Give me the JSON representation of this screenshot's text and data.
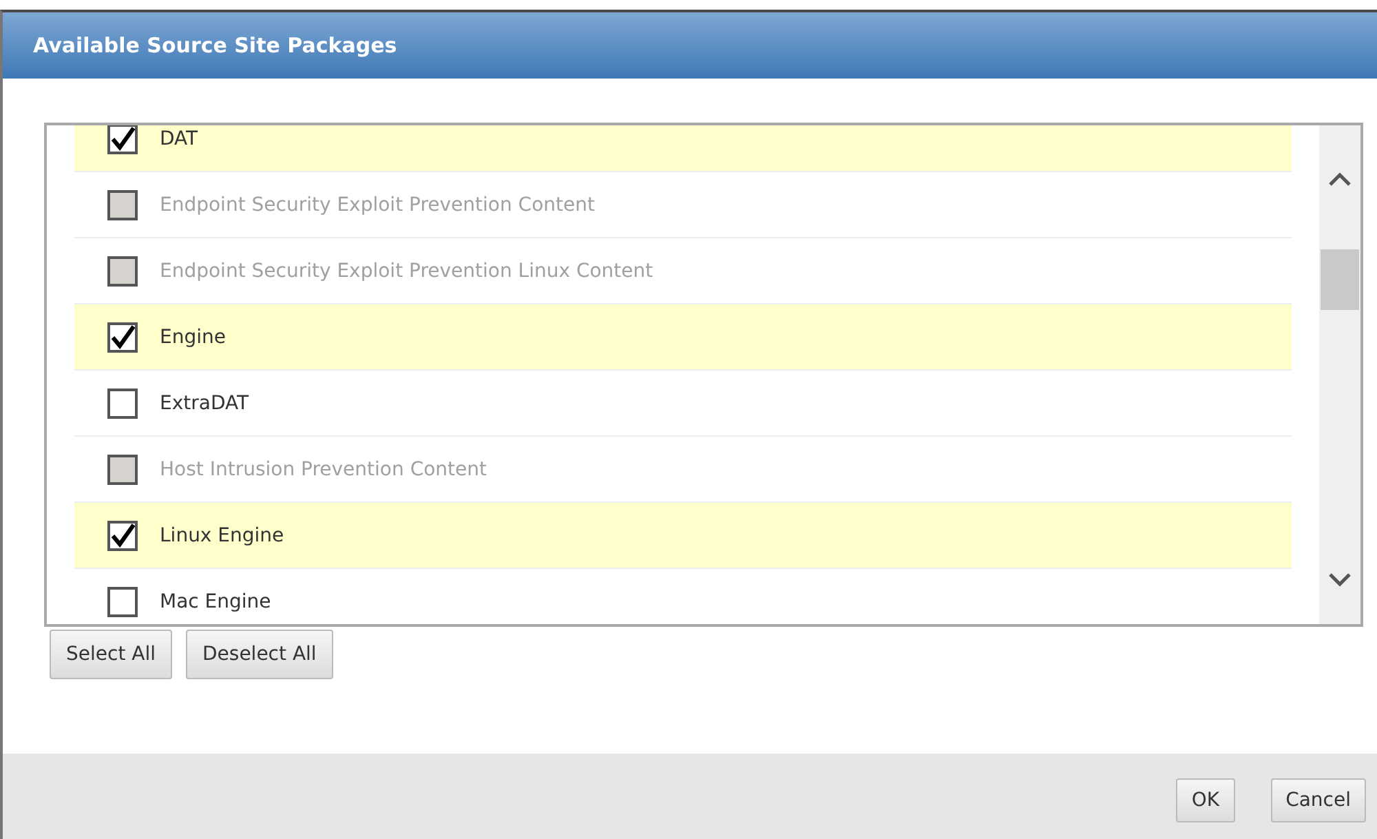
{
  "dialog": {
    "title": "Available Source Site Packages"
  },
  "packages": [
    {
      "label": "DAT",
      "checked": true,
      "disabled": false
    },
    {
      "label": "Endpoint Security Exploit Prevention Content",
      "checked": false,
      "disabled": true
    },
    {
      "label": "Endpoint Security Exploit Prevention Linux Content",
      "checked": false,
      "disabled": true
    },
    {
      "label": "Engine",
      "checked": true,
      "disabled": false
    },
    {
      "label": "ExtraDAT",
      "checked": false,
      "disabled": false
    },
    {
      "label": "Host Intrusion Prevention Content",
      "checked": false,
      "disabled": true
    },
    {
      "label": "Linux Engine",
      "checked": true,
      "disabled": false
    },
    {
      "label": "Mac Engine",
      "checked": false,
      "disabled": false
    }
  ],
  "list_buttons": [
    "Select All",
    "Deselect All"
  ],
  "footer_buttons": [
    "OK",
    "Cancel"
  ]
}
